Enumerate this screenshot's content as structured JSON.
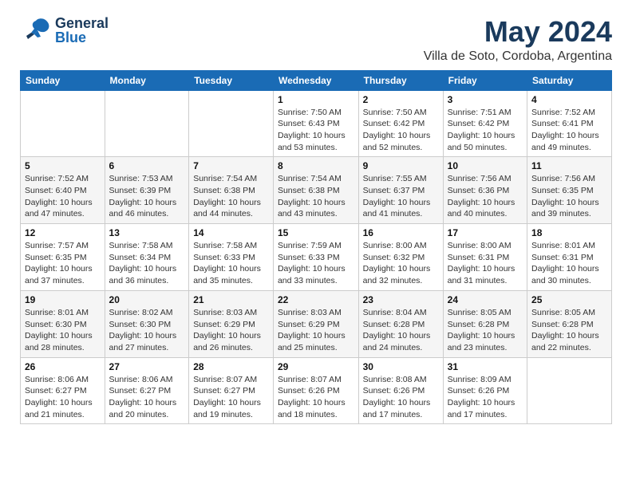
{
  "header": {
    "logo_general": "General",
    "logo_blue": "Blue",
    "title": "May 2024",
    "subtitle": "Villa de Soto, Cordoba, Argentina"
  },
  "days_of_week": [
    "Sunday",
    "Monday",
    "Tuesday",
    "Wednesday",
    "Thursday",
    "Friday",
    "Saturday"
  ],
  "weeks": [
    [
      {
        "day": "",
        "detail": ""
      },
      {
        "day": "",
        "detail": ""
      },
      {
        "day": "",
        "detail": ""
      },
      {
        "day": "1",
        "sunrise": "Sunrise: 7:50 AM",
        "sunset": "Sunset: 6:43 PM",
        "daylight": "Daylight: 10 hours and 53 minutes."
      },
      {
        "day": "2",
        "sunrise": "Sunrise: 7:50 AM",
        "sunset": "Sunset: 6:42 PM",
        "daylight": "Daylight: 10 hours and 52 minutes."
      },
      {
        "day": "3",
        "sunrise": "Sunrise: 7:51 AM",
        "sunset": "Sunset: 6:42 PM",
        "daylight": "Daylight: 10 hours and 50 minutes."
      },
      {
        "day": "4",
        "sunrise": "Sunrise: 7:52 AM",
        "sunset": "Sunset: 6:41 PM",
        "daylight": "Daylight: 10 hours and 49 minutes."
      }
    ],
    [
      {
        "day": "5",
        "sunrise": "Sunrise: 7:52 AM",
        "sunset": "Sunset: 6:40 PM",
        "daylight": "Daylight: 10 hours and 47 minutes."
      },
      {
        "day": "6",
        "sunrise": "Sunrise: 7:53 AM",
        "sunset": "Sunset: 6:39 PM",
        "daylight": "Daylight: 10 hours and 46 minutes."
      },
      {
        "day": "7",
        "sunrise": "Sunrise: 7:54 AM",
        "sunset": "Sunset: 6:38 PM",
        "daylight": "Daylight: 10 hours and 44 minutes."
      },
      {
        "day": "8",
        "sunrise": "Sunrise: 7:54 AM",
        "sunset": "Sunset: 6:38 PM",
        "daylight": "Daylight: 10 hours and 43 minutes."
      },
      {
        "day": "9",
        "sunrise": "Sunrise: 7:55 AM",
        "sunset": "Sunset: 6:37 PM",
        "daylight": "Daylight: 10 hours and 41 minutes."
      },
      {
        "day": "10",
        "sunrise": "Sunrise: 7:56 AM",
        "sunset": "Sunset: 6:36 PM",
        "daylight": "Daylight: 10 hours and 40 minutes."
      },
      {
        "day": "11",
        "sunrise": "Sunrise: 7:56 AM",
        "sunset": "Sunset: 6:35 PM",
        "daylight": "Daylight: 10 hours and 39 minutes."
      }
    ],
    [
      {
        "day": "12",
        "sunrise": "Sunrise: 7:57 AM",
        "sunset": "Sunset: 6:35 PM",
        "daylight": "Daylight: 10 hours and 37 minutes."
      },
      {
        "day": "13",
        "sunrise": "Sunrise: 7:58 AM",
        "sunset": "Sunset: 6:34 PM",
        "daylight": "Daylight: 10 hours and 36 minutes."
      },
      {
        "day": "14",
        "sunrise": "Sunrise: 7:58 AM",
        "sunset": "Sunset: 6:33 PM",
        "daylight": "Daylight: 10 hours and 35 minutes."
      },
      {
        "day": "15",
        "sunrise": "Sunrise: 7:59 AM",
        "sunset": "Sunset: 6:33 PM",
        "daylight": "Daylight: 10 hours and 33 minutes."
      },
      {
        "day": "16",
        "sunrise": "Sunrise: 8:00 AM",
        "sunset": "Sunset: 6:32 PM",
        "daylight": "Daylight: 10 hours and 32 minutes."
      },
      {
        "day": "17",
        "sunrise": "Sunrise: 8:00 AM",
        "sunset": "Sunset: 6:31 PM",
        "daylight": "Daylight: 10 hours and 31 minutes."
      },
      {
        "day": "18",
        "sunrise": "Sunrise: 8:01 AM",
        "sunset": "Sunset: 6:31 PM",
        "daylight": "Daylight: 10 hours and 30 minutes."
      }
    ],
    [
      {
        "day": "19",
        "sunrise": "Sunrise: 8:01 AM",
        "sunset": "Sunset: 6:30 PM",
        "daylight": "Daylight: 10 hours and 28 minutes."
      },
      {
        "day": "20",
        "sunrise": "Sunrise: 8:02 AM",
        "sunset": "Sunset: 6:30 PM",
        "daylight": "Daylight: 10 hours and 27 minutes."
      },
      {
        "day": "21",
        "sunrise": "Sunrise: 8:03 AM",
        "sunset": "Sunset: 6:29 PM",
        "daylight": "Daylight: 10 hours and 26 minutes."
      },
      {
        "day": "22",
        "sunrise": "Sunrise: 8:03 AM",
        "sunset": "Sunset: 6:29 PM",
        "daylight": "Daylight: 10 hours and 25 minutes."
      },
      {
        "day": "23",
        "sunrise": "Sunrise: 8:04 AM",
        "sunset": "Sunset: 6:28 PM",
        "daylight": "Daylight: 10 hours and 24 minutes."
      },
      {
        "day": "24",
        "sunrise": "Sunrise: 8:05 AM",
        "sunset": "Sunset: 6:28 PM",
        "daylight": "Daylight: 10 hours and 23 minutes."
      },
      {
        "day": "25",
        "sunrise": "Sunrise: 8:05 AM",
        "sunset": "Sunset: 6:28 PM",
        "daylight": "Daylight: 10 hours and 22 minutes."
      }
    ],
    [
      {
        "day": "26",
        "sunrise": "Sunrise: 8:06 AM",
        "sunset": "Sunset: 6:27 PM",
        "daylight": "Daylight: 10 hours and 21 minutes."
      },
      {
        "day": "27",
        "sunrise": "Sunrise: 8:06 AM",
        "sunset": "Sunset: 6:27 PM",
        "daylight": "Daylight: 10 hours and 20 minutes."
      },
      {
        "day": "28",
        "sunrise": "Sunrise: 8:07 AM",
        "sunset": "Sunset: 6:27 PM",
        "daylight": "Daylight: 10 hours and 19 minutes."
      },
      {
        "day": "29",
        "sunrise": "Sunrise: 8:07 AM",
        "sunset": "Sunset: 6:26 PM",
        "daylight": "Daylight: 10 hours and 18 minutes."
      },
      {
        "day": "30",
        "sunrise": "Sunrise: 8:08 AM",
        "sunset": "Sunset: 6:26 PM",
        "daylight": "Daylight: 10 hours and 17 minutes."
      },
      {
        "day": "31",
        "sunrise": "Sunrise: 8:09 AM",
        "sunset": "Sunset: 6:26 PM",
        "daylight": "Daylight: 10 hours and 17 minutes."
      },
      {
        "day": "",
        "detail": ""
      }
    ]
  ]
}
